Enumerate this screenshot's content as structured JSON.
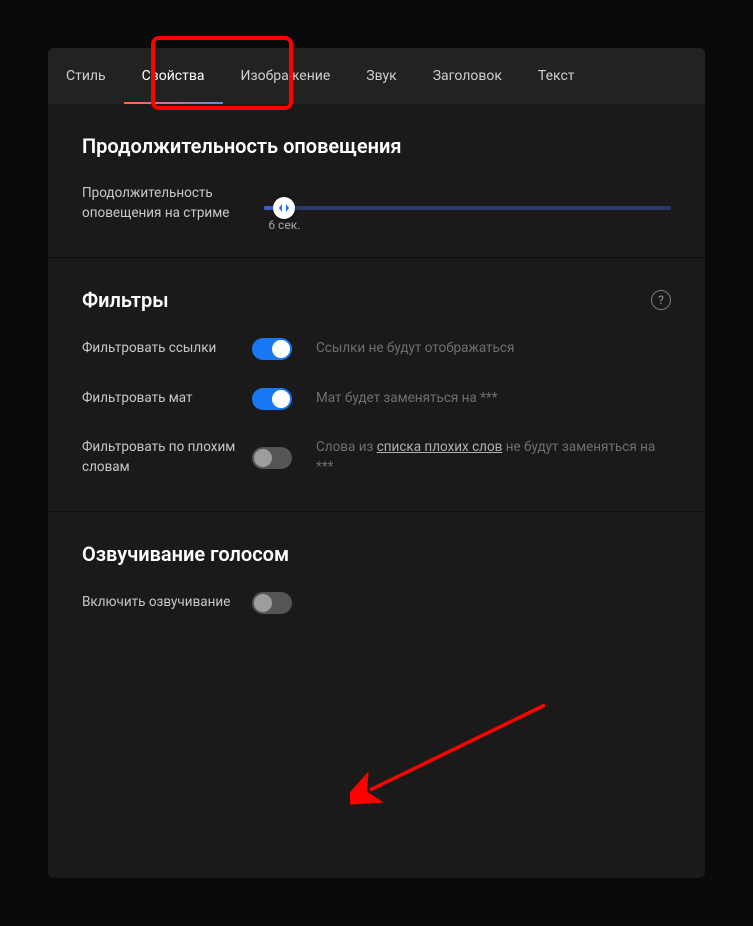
{
  "tabs": {
    "items": [
      {
        "label": "Стиль",
        "active": false
      },
      {
        "label": "Свойства",
        "active": true
      },
      {
        "label": "Изображение",
        "active": false
      },
      {
        "label": "Звук",
        "active": false
      },
      {
        "label": "Заголовок",
        "active": false
      },
      {
        "label": "Текст",
        "active": false
      }
    ]
  },
  "duration": {
    "title": "Продолжительность оповещения",
    "label": "Продолжительность оповещения на стриме",
    "value_text": "6 сек.",
    "value_pct": 5
  },
  "filters": {
    "title": "Фильтры",
    "rows": [
      {
        "label": "Фильтровать ссылки",
        "on": true,
        "desc_pre": "Ссылки не будут отображаться",
        "link": "",
        "desc_post": ""
      },
      {
        "label": "Фильтровать мат",
        "on": true,
        "desc_pre": "Мат будет заменяться на ***",
        "link": "",
        "desc_post": ""
      },
      {
        "label": "Фильтровать по плохим словам",
        "on": false,
        "desc_pre": "Слова из ",
        "link": "списка плохих слов",
        "desc_post": " не будут заменяться на ***"
      }
    ]
  },
  "voice": {
    "title": "Озвучивание голосом",
    "label": "Включить озвучивание",
    "on": false
  }
}
